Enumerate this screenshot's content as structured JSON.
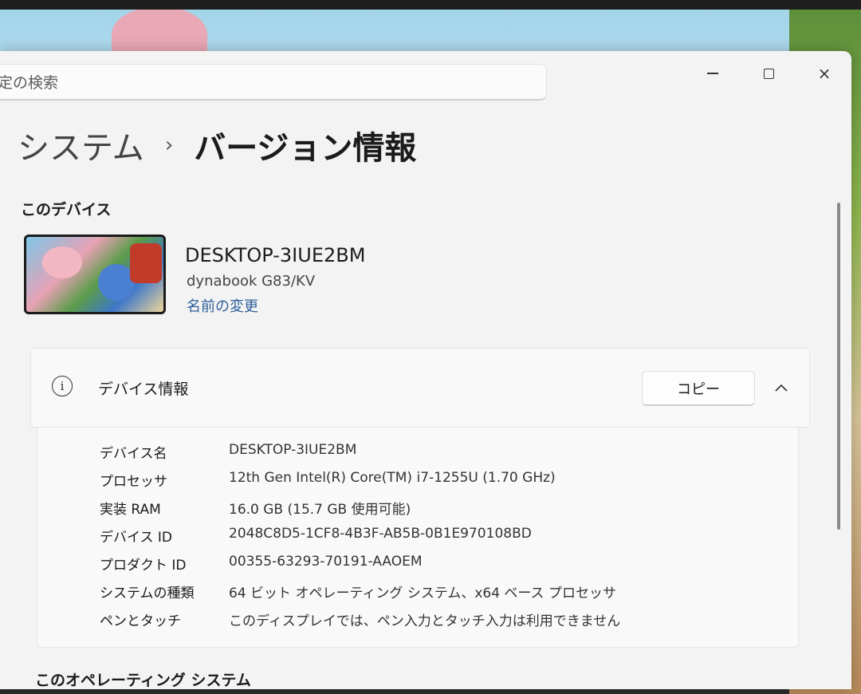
{
  "search": {
    "placeholder": "定の検索"
  },
  "window_controls": {
    "minimize": "minimize",
    "maximize": "maximize",
    "close": "×"
  },
  "header": {
    "parent": "システム",
    "separator": "›",
    "title": "バージョン情報"
  },
  "device_section": {
    "label": "このデバイス",
    "name": "DESKTOP-3IUE2BM",
    "model": "dynabook G83/KV",
    "rename_link": "名前の変更"
  },
  "device_info_card": {
    "icon": "info-icon",
    "title": "デバイス情報",
    "copy_label": "コピー",
    "specs": [
      {
        "label": "デバイス名",
        "value": "DESKTOP-3IUE2BM"
      },
      {
        "label": "プロセッサ",
        "value": "12th Gen Intel(R) Core(TM) i7-1255U (1.70 GHz)"
      },
      {
        "label": "実装 RAM",
        "value": "16.0 GB (15.7 GB 使用可能)"
      },
      {
        "label": "デバイス ID",
        "value": "2048C8D5-1CF8-4B3F-AB5B-0B1E970108BD"
      },
      {
        "label": "プロダクト ID",
        "value": "00355-63293-70191-AAOEM"
      },
      {
        "label": "システムの種類",
        "value": "64 ビット オペレーティング システム、x64 ベース プロセッサ"
      },
      {
        "label": "ペンとタッチ",
        "value": "このディスプレイでは、ペン入力とタッチ入力は利用できません"
      }
    ]
  },
  "os_section": {
    "label": "このオペレーティング システム"
  },
  "colors": {
    "window_bg": "#f3f3f3",
    "card_bg": "#f9f9f9",
    "link": "#2f5f9a"
  }
}
